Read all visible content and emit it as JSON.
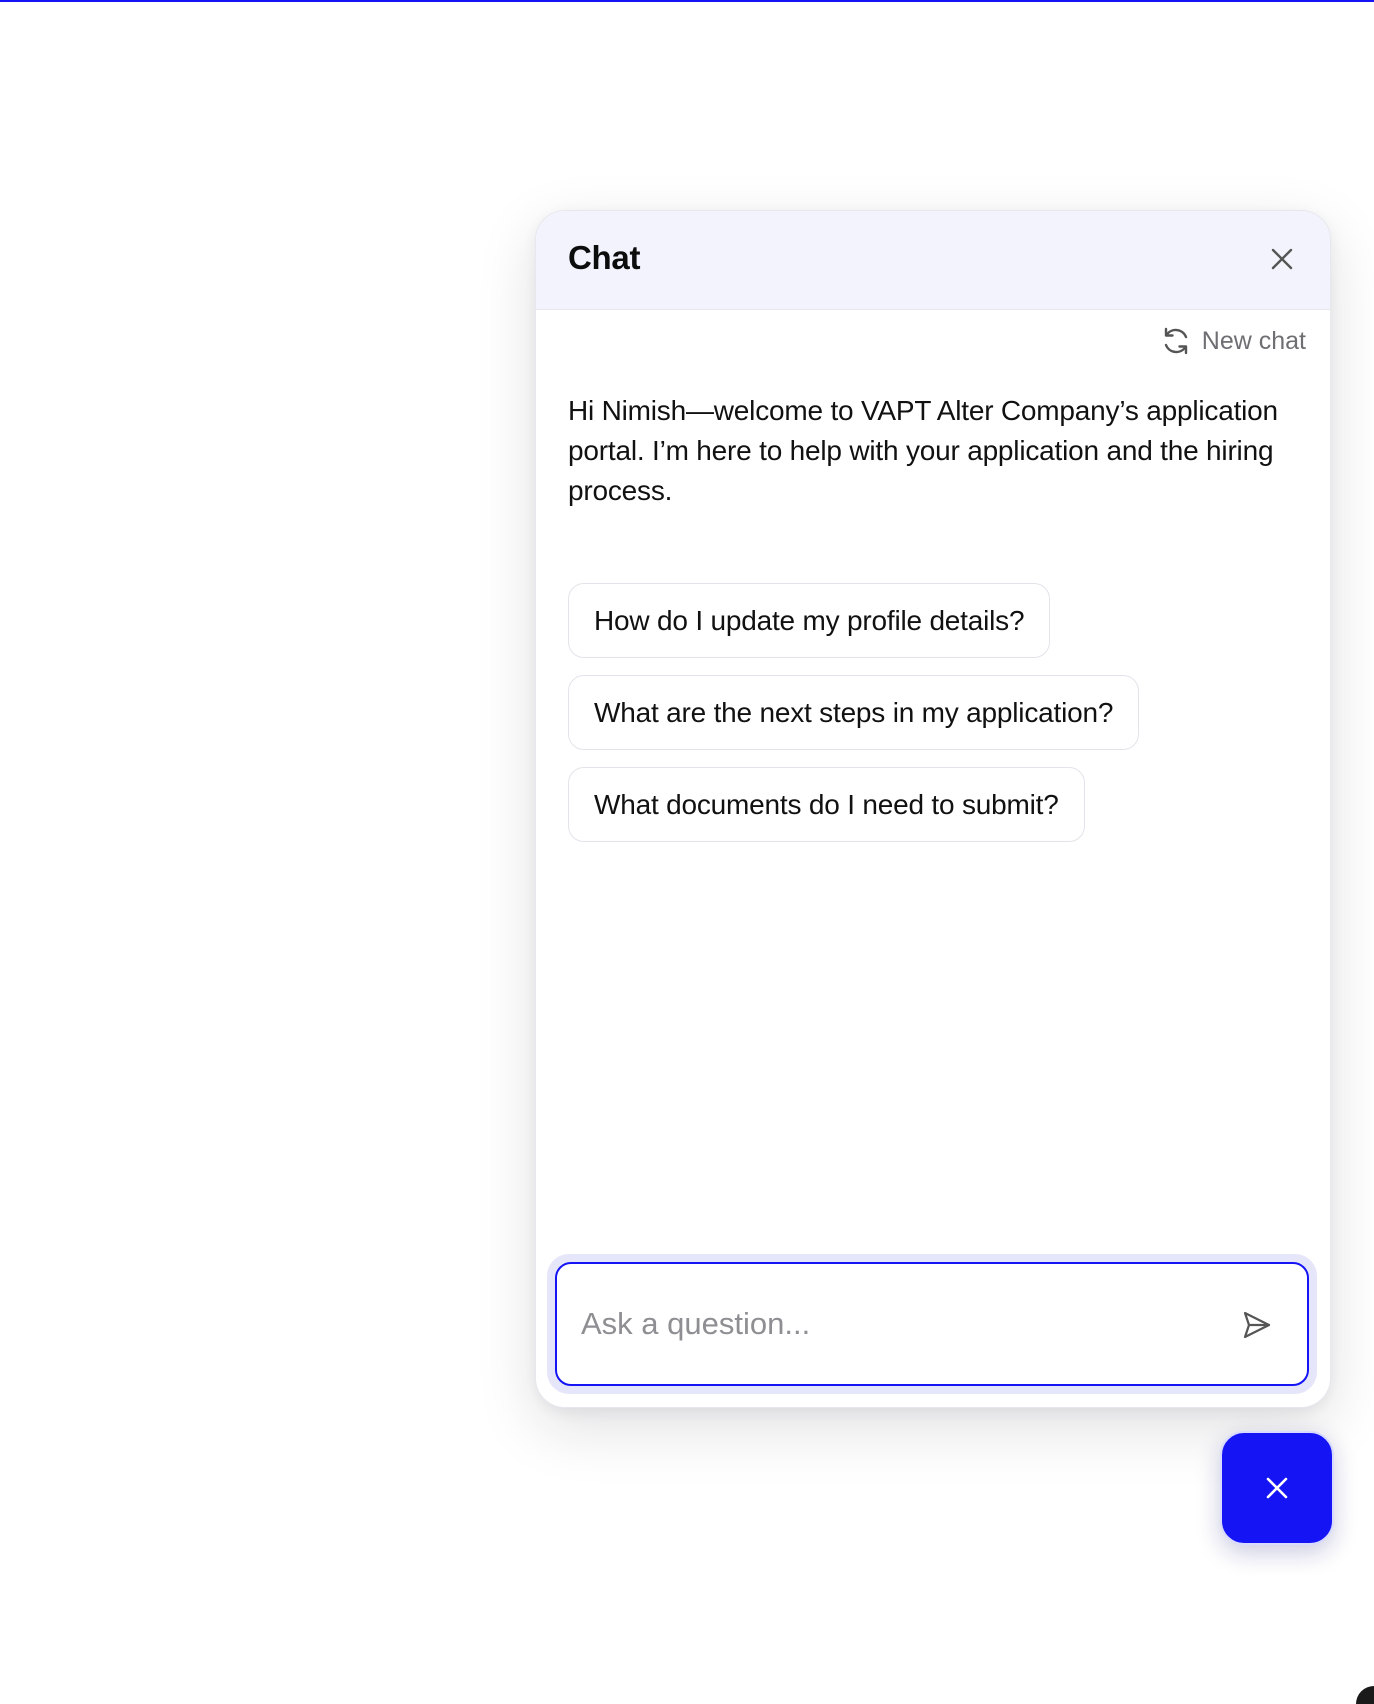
{
  "colors": {
    "accent": "#1414f5",
    "header_bg": "#f3f3fd",
    "input_halo": "#e6e6fb",
    "muted_text": "#6e6e73",
    "icon_gray": "#555555"
  },
  "chat": {
    "title": "Chat",
    "close_icon": "close-icon",
    "new_chat": {
      "icon": "refresh-icon",
      "label": "New chat"
    },
    "welcome_message": "Hi Nimish—welcome to VAPT Alter Company’s application portal. I’m here to help with your application and the hiring process.",
    "suggestions": [
      "How do I update my profile details?",
      "What are the next steps in my application?",
      "What documents do I need to submit?"
    ],
    "input": {
      "placeholder": "Ask a question...",
      "value": ""
    },
    "send_icon": "send-icon"
  },
  "launcher": {
    "icon": "close-icon"
  }
}
